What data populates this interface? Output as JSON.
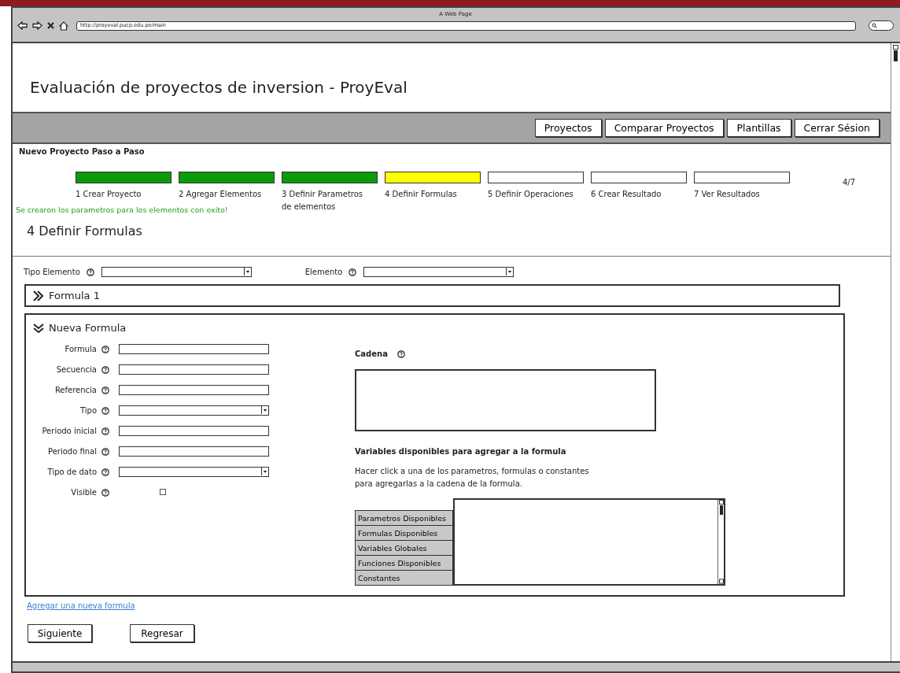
{
  "browser": {
    "title": "A Web Page",
    "url": "http://proyeval.pucp.edu.pe/main"
  },
  "app_title": "Evaluación de proyectos de inversion - ProyEval",
  "nav": [
    "Proyectos",
    "Comparar Proyectos",
    "Plantillas",
    "Cerrar Sésion"
  ],
  "wizard": {
    "title": "Nuevo Proyecto Paso a Paso",
    "counter": "4/7",
    "message": "Se crearon los parametros para los elementos con exito!",
    "steps": [
      {
        "label": "1 Crear Proyecto",
        "completed": true,
        "current": false
      },
      {
        "label": "2 Agregar Elementos",
        "completed": true,
        "current": false
      },
      {
        "label": "3 Definir Parametros de elementos",
        "completed": true,
        "current": false
      },
      {
        "label": "4 Definir Formulas",
        "completed": false,
        "current": true
      },
      {
        "label": "5 Definir Operaciones",
        "completed": false,
        "current": false
      },
      {
        "label": "6 Crear Resultado",
        "completed": false,
        "current": false
      },
      {
        "label": "7 Ver Resultados",
        "completed": false,
        "current": false
      }
    ]
  },
  "section_title": "4 Definir Formulas",
  "filters": [
    {
      "label": "Tipo Elemento"
    },
    {
      "label": "Elemento"
    }
  ],
  "formulas": [
    {
      "title": "Formula 1",
      "expanded": false
    },
    {
      "title": "Nueva Formula",
      "expanded": true
    }
  ],
  "form": {
    "fields": [
      {
        "label": "Formula",
        "kind": "text"
      },
      {
        "label": "Secuencia",
        "kind": "text"
      },
      {
        "label": "Referencia",
        "kind": "text"
      },
      {
        "label": "Tipo",
        "kind": "select"
      },
      {
        "label": "Periodo inicial",
        "kind": "text"
      },
      {
        "label": "Periodo final",
        "kind": "text"
      },
      {
        "label": "Tipo de dato",
        "kind": "select"
      },
      {
        "label": "Visible",
        "kind": "checkbox",
        "checked": false
      }
    ],
    "cadena_label": "Cadena",
    "variables_title": "Variables disponibles para agregar a la formula",
    "instructions": "Hacer click a una de los parametros, formulas o constantes para agregarlas a la cadena de la formula.",
    "categories": [
      "Parametros Disponibles",
      "Formulas Disponibles",
      "Variables Globales",
      "Funciones Disponibles",
      "Constantes"
    ]
  },
  "link": "Agregar una nueva formula",
  "buttons": [
    "Siguiente",
    "Regresar"
  ]
}
